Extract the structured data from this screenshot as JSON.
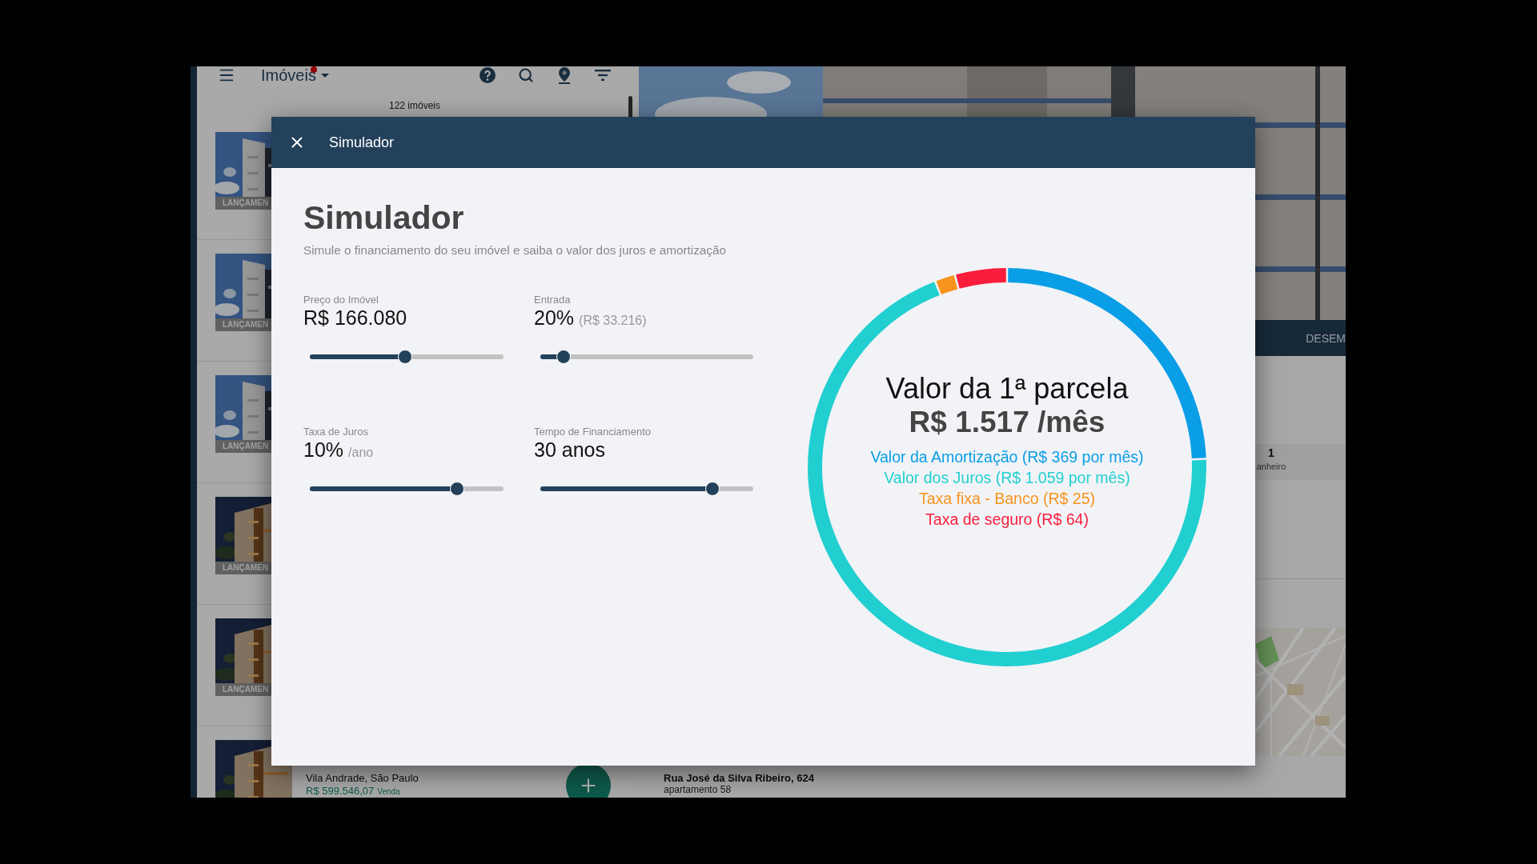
{
  "background_app": {
    "toolbar": {
      "title": "Imóveis"
    },
    "count": "122 imóveis",
    "listings": [
      {
        "badge": "LANÇAMEN"
      },
      {
        "badge": "LANÇAMEN"
      },
      {
        "badge": "LANÇAMEN"
      },
      {
        "badge": "LANÇAMEN"
      },
      {
        "badge": "LANÇAMEN"
      },
      {
        "address": "Vila Andrade, São Paulo",
        "price": "R$ 599.546,07",
        "deal": "Venda"
      }
    ],
    "detail": {
      "tab": "DESEM",
      "feature": {
        "value": "1",
        "label": "anheiro"
      },
      "address": "Rua José da Silva Ribeiro, 624",
      "unit": "apartamento 58"
    }
  },
  "dialog": {
    "title": "Simulador",
    "heading": "Simulador",
    "subtitle": "Simule o financiamento do seu imóvel e saiba o valor dos juros e amortização",
    "inputs": [
      {
        "label": "Preço do Imóvel",
        "value": "R$ 166.080",
        "level": 0.49
      },
      {
        "label": "Entrada",
        "value": "20%",
        "note": "(R$ 33.216)",
        "level": 0.11
      },
      {
        "label": "Taxa de Juros",
        "value": "10%",
        "note": "/ano",
        "level": 0.76
      },
      {
        "label": "Tempo de Financiamento",
        "value": "30 anos",
        "level": 0.81
      }
    ],
    "result": {
      "amount": "R$ 1.517 /mês",
      "legend": [
        {
          "color": "#0a9ee6"
        },
        {
          "color": "#22cfd0"
        },
        {
          "color": "#f7941d"
        },
        {
          "color": "#fa1e3c"
        }
      ],
      "chart_data": {
        "type": "donut",
        "title": "Valor da 1ª parcela",
        "categories": [
          "Valor da Amortização (R$ 369 por mês)",
          "Valor dos Juros (R$ 1.059 por mês)",
          "Taxa fixa - Banco (R$ 25)",
          "Taxa de seguro (R$ 64)"
        ],
        "values": [
          369,
          1059,
          25,
          64
        ]
      }
    }
  }
}
